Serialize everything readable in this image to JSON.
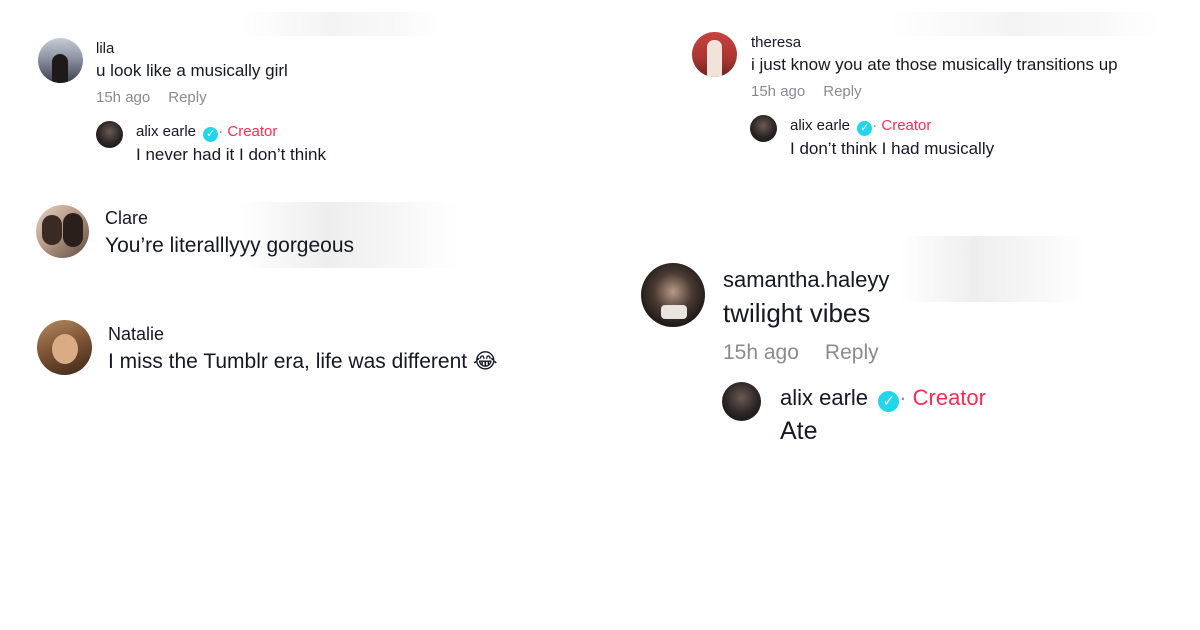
{
  "threads": [
    {
      "user": "lila",
      "text": "u look like a musically girl",
      "time": "15h ago",
      "reply_label": "Reply",
      "reply": {
        "user": "alix earle",
        "badge": "Creator",
        "text": "I never had it I don’t think"
      }
    },
    {
      "user": "Clare",
      "text": "You’re literalllyyy gorgeous"
    },
    {
      "user": "Natalie",
      "text": "I miss the Tumblr era, life was different",
      "emoji": "😂"
    },
    {
      "user": "theresa",
      "text": "i just know you ate those musically transitions up",
      "time": "15h ago",
      "reply_label": "Reply",
      "reply": {
        "user": "alix earle",
        "badge": "Creator",
        "text": "I don’t think I had musically"
      }
    },
    {
      "user": "samantha.haleyy",
      "text": "twilight vibes",
      "time": "15h ago",
      "reply_label": "Reply",
      "reply": {
        "user": "alix earle",
        "badge": "Creator",
        "text": "Ate"
      }
    }
  ],
  "icons": {
    "verified": "verified-check-icon"
  },
  "colors": {
    "creator": "#fe2c55",
    "verified": "#20d5ec",
    "meta": "#8a8b91"
  }
}
